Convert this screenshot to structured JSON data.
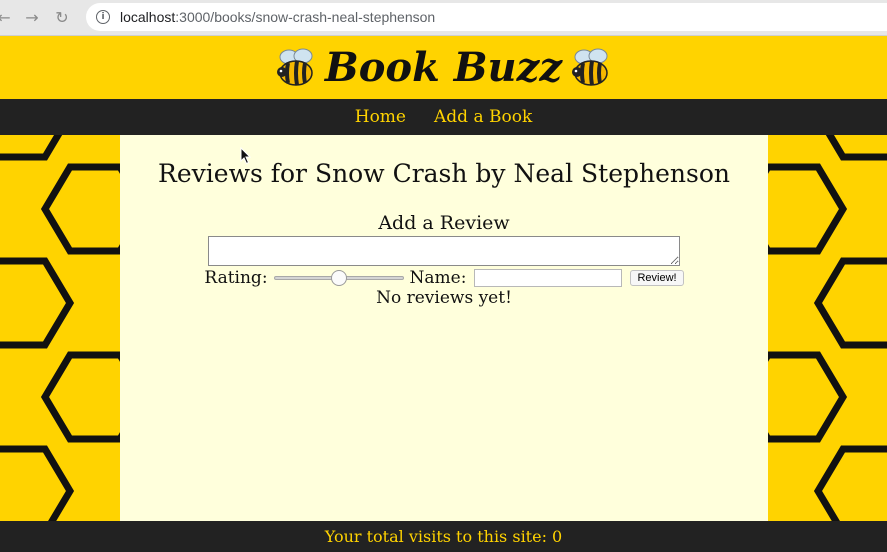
{
  "browser": {
    "url_host": "localhost",
    "url_path": ":3000/books/snow-crash-neal-stephenson",
    "back_icon": "back-arrow-icon",
    "forward_icon": "forward-arrow-icon",
    "reload_icon": "reload-icon"
  },
  "header": {
    "brand": "Book Buzz",
    "logo_icon": "bee-icon"
  },
  "nav": {
    "items": [
      {
        "label": "Home"
      },
      {
        "label": "Add a Book"
      }
    ]
  },
  "main": {
    "title": "Reviews for Snow Crash by Neal Stephenson",
    "form": {
      "heading": "Add a Review",
      "review_value": "",
      "rating_label": "Rating:",
      "rating_value": 0.5,
      "name_label": "Name:",
      "name_value": "",
      "submit_label": "Review!"
    },
    "empty_message": "No reviews yet!"
  },
  "footer": {
    "text": "Your total visits to this site: 0"
  },
  "colors": {
    "brand_yellow": "#ffd300",
    "dark": "#222222",
    "content_bg": "#ffffdc"
  }
}
